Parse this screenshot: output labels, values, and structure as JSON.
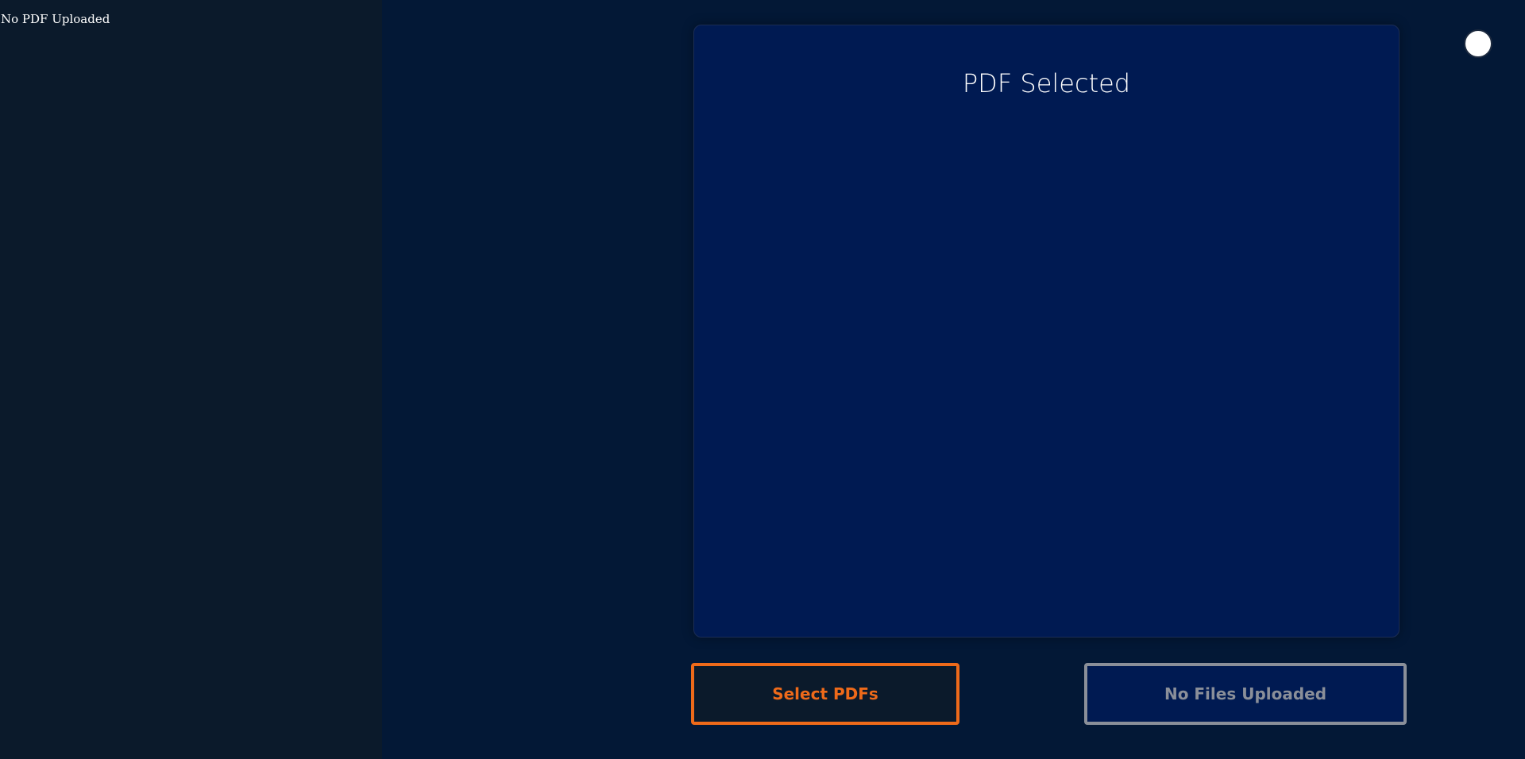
{
  "sidebar": {
    "status_text": "No PDF Uploaded"
  },
  "preview": {
    "title": "PDF Selected"
  },
  "actions": {
    "select_label": "Select PDFs",
    "upload_label": "No Files Uploaded"
  },
  "colors": {
    "page_background": "#031836",
    "sidebar_background": "#0b1a2b",
    "panel_background": "#001a52",
    "accent_orange": "#ee6a1a",
    "disabled_gray": "#8a8f99",
    "text_white": "#ffffff"
  }
}
